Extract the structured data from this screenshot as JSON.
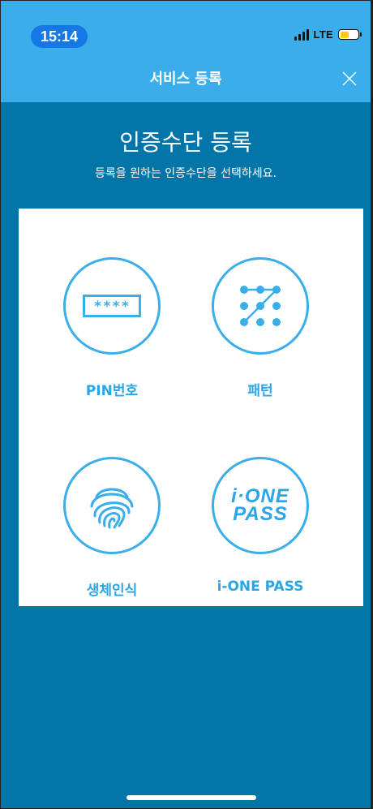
{
  "status_bar": {
    "time": "15:14",
    "network": "LTE"
  },
  "nav": {
    "title": "서비스 등록"
  },
  "main": {
    "heading": "인증수단 등록",
    "subheading": "등록을 원하는 인증수단을 선택하세요."
  },
  "options": {
    "pin": {
      "label": "PIN번호",
      "icon_text": "****"
    },
    "pattern": {
      "label": "패턴"
    },
    "biometric": {
      "label": "생체인식"
    },
    "ione_pass": {
      "label": "i-ONE PASS",
      "logo_line1": "i·ONE",
      "logo_line2": "PASS"
    }
  },
  "colors": {
    "accent": "#3aaeea",
    "background": "#0475a8",
    "card": "#ffffff",
    "time_pill": "#1677e6",
    "battery": "#ffcc00"
  }
}
